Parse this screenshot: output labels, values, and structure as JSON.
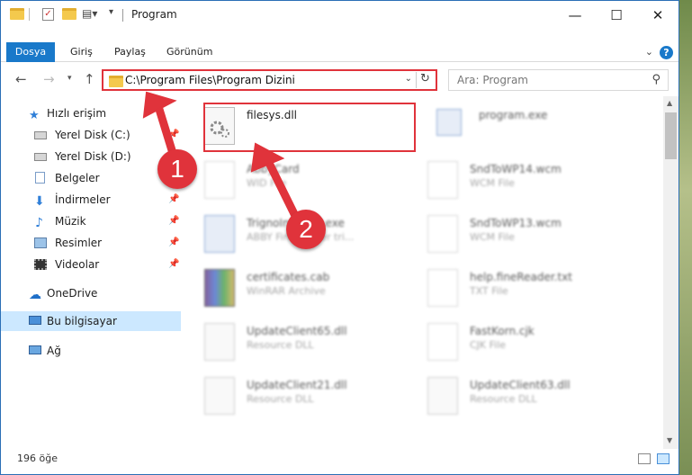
{
  "window": {
    "title": "Program"
  },
  "ribbon": {
    "tabs": [
      "Dosya",
      "Giriş",
      "Paylaş",
      "Görünüm"
    ]
  },
  "nav": {
    "address": "C:\\Program Files\\Program Dizini",
    "search_placeholder": "Ara: Program"
  },
  "sidebar": {
    "quick_access": "Hızlı erişim",
    "items": [
      "Yerel Disk (C:)",
      "Yerel Disk (D:)",
      "Belgeler",
      "İndirmeler",
      "Müzik",
      "Resimler",
      "Videolar"
    ],
    "onedrive": "OneDrive",
    "this_pc": "Bu bilgisayar",
    "network": "Ağ"
  },
  "files": [
    {
      "name": "filesys.dll",
      "type": ""
    },
    {
      "name": "program.exe",
      "type": ""
    },
    {
      "name": "AbbyCard",
      "type": "WID File"
    },
    {
      "name": "SndToWP14.wcm",
      "type": "WCM File"
    },
    {
      "name": "TrignoInstaller.exe",
      "type": "ABBY FineReader tri..."
    },
    {
      "name": "SndToWP13.wcm",
      "type": "WCM File"
    },
    {
      "name": "certificates.cab",
      "type": "WinRAR Archive"
    },
    {
      "name": "help.fineReader.txt",
      "type": "TXT File"
    },
    {
      "name": "UpdateClient65.dll",
      "type": "Resource DLL"
    },
    {
      "name": "FastKorn.cjk",
      "type": "CJK File"
    },
    {
      "name": "UpdateClient21.dll",
      "type": "Resource DLL"
    },
    {
      "name": "UpdateClient63.dll",
      "type": "Resource DLL"
    }
  ],
  "status": {
    "count": "196 öğe"
  },
  "annotations": {
    "step1": "1",
    "step2": "2"
  },
  "colors": {
    "accent": "#1979ca",
    "highlight": "#e0333b",
    "selected": "#cce8ff"
  }
}
